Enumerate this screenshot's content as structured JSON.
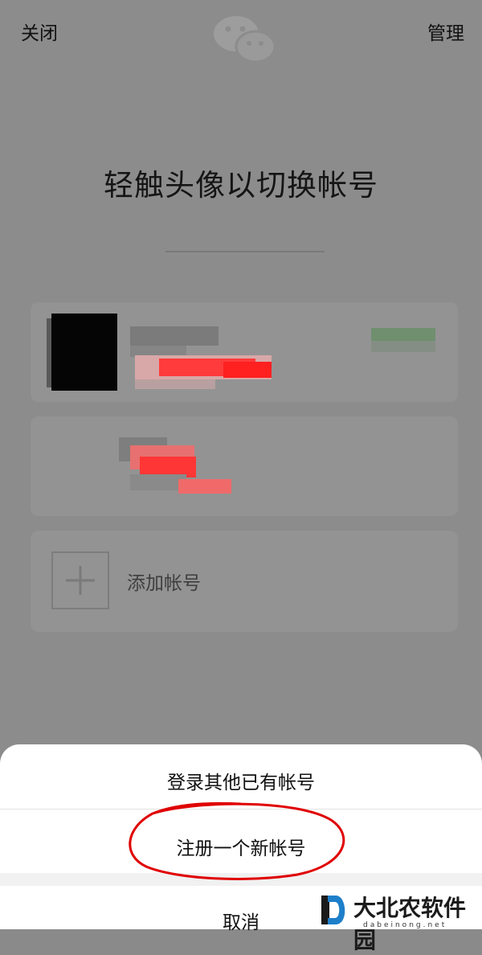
{
  "top_bar": {
    "close_label": "关闭",
    "manage_label": "管理"
  },
  "title": "轻触头像以切换帐号",
  "add_account_label": "添加帐号",
  "sheet": {
    "login_other": "登录其他已有帐号",
    "register_new": "注册一个新帐号",
    "cancel": "取消"
  },
  "watermark": {
    "text": "大北农软件园",
    "domain": "dabeinong.net"
  },
  "icons": [
    "wechat-logo-icon",
    "plus-icon",
    "watermark-logo-icon"
  ],
  "colors": {
    "overlay": "#8c8c8c",
    "sheet": "#ffffff",
    "annotation_red": "#e00000"
  }
}
